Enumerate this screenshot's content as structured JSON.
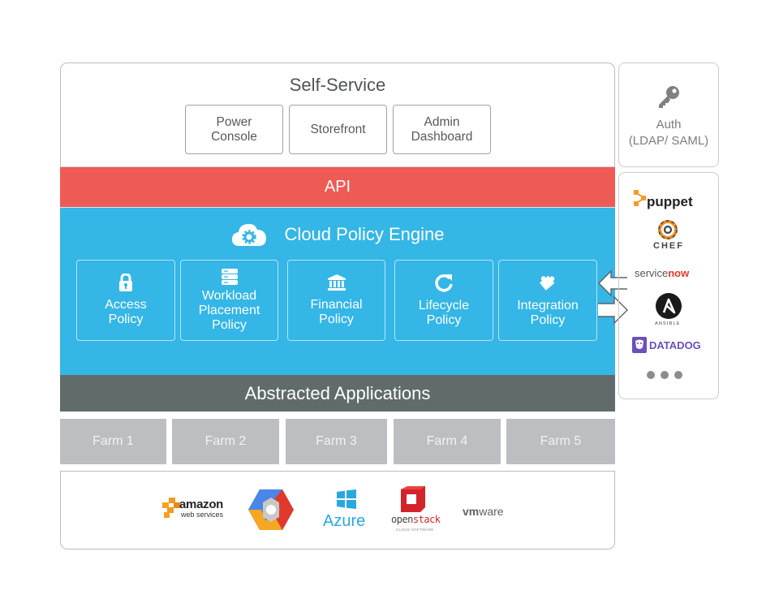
{
  "self_service": {
    "title": "Self-Service",
    "items": [
      {
        "line1": "Power",
        "line2": "Console"
      },
      {
        "line1": "Storefront",
        "line2": ""
      },
      {
        "line1": "Admin",
        "line2": "Dashboard"
      }
    ]
  },
  "api": {
    "label": "API"
  },
  "engine": {
    "title": "Cloud Policy Engine",
    "icon": "cloud-gear-icon",
    "policies": [
      {
        "lines": [
          "Access",
          "Policy"
        ],
        "icon": "lock-icon"
      },
      {
        "lines": [
          "Workload",
          "Placement",
          "Policy"
        ],
        "icon": "server-stack-icon"
      },
      {
        "lines": [
          "Financial",
          "Policy"
        ],
        "icon": "bank-icon"
      },
      {
        "lines": [
          "Lifecycle",
          "Policy"
        ],
        "icon": "refresh-icon"
      },
      {
        "lines": [
          "Integration",
          "Policy"
        ],
        "icon": "puzzle-icon"
      }
    ]
  },
  "abstracted": {
    "label": "Abstracted Applications"
  },
  "farms": [
    "Farm 1",
    "Farm 2",
    "Farm 3",
    "Farm 4",
    "Farm 5"
  ],
  "providers": {
    "aws": {
      "line1": "amazon",
      "line2": "web services"
    },
    "google_cloud": {
      "icon": "google-cloud-hexagon-icon"
    },
    "azure": {
      "label": "Azure"
    },
    "openstack": {
      "part1": "open",
      "part2": "stack",
      "tagline": "CLOUD SOFTWARE"
    },
    "vmware": {
      "part1": "vm",
      "part2": "ware"
    }
  },
  "auth": {
    "title": "Auth",
    "subtitle": "(LDAP/ SAML)",
    "icon": "key-icon"
  },
  "integrations": {
    "puppet": "puppet",
    "chef": "CHEF",
    "servicenow": {
      "part1": "service",
      "part2": "now"
    },
    "ansible": {
      "letter": "A",
      "label": "ANSIBLE"
    },
    "datadog": "DATADOG",
    "more": "more-dots-icon"
  },
  "colors": {
    "api": "#ee5b55",
    "engine": "#34b6e6",
    "abstracted": "#626b6b",
    "farm": "#bdbec1",
    "puppet_orange": "#f39a2b",
    "servicenow_red": "#e2392b",
    "datadog_purple": "#6b4fbb"
  }
}
